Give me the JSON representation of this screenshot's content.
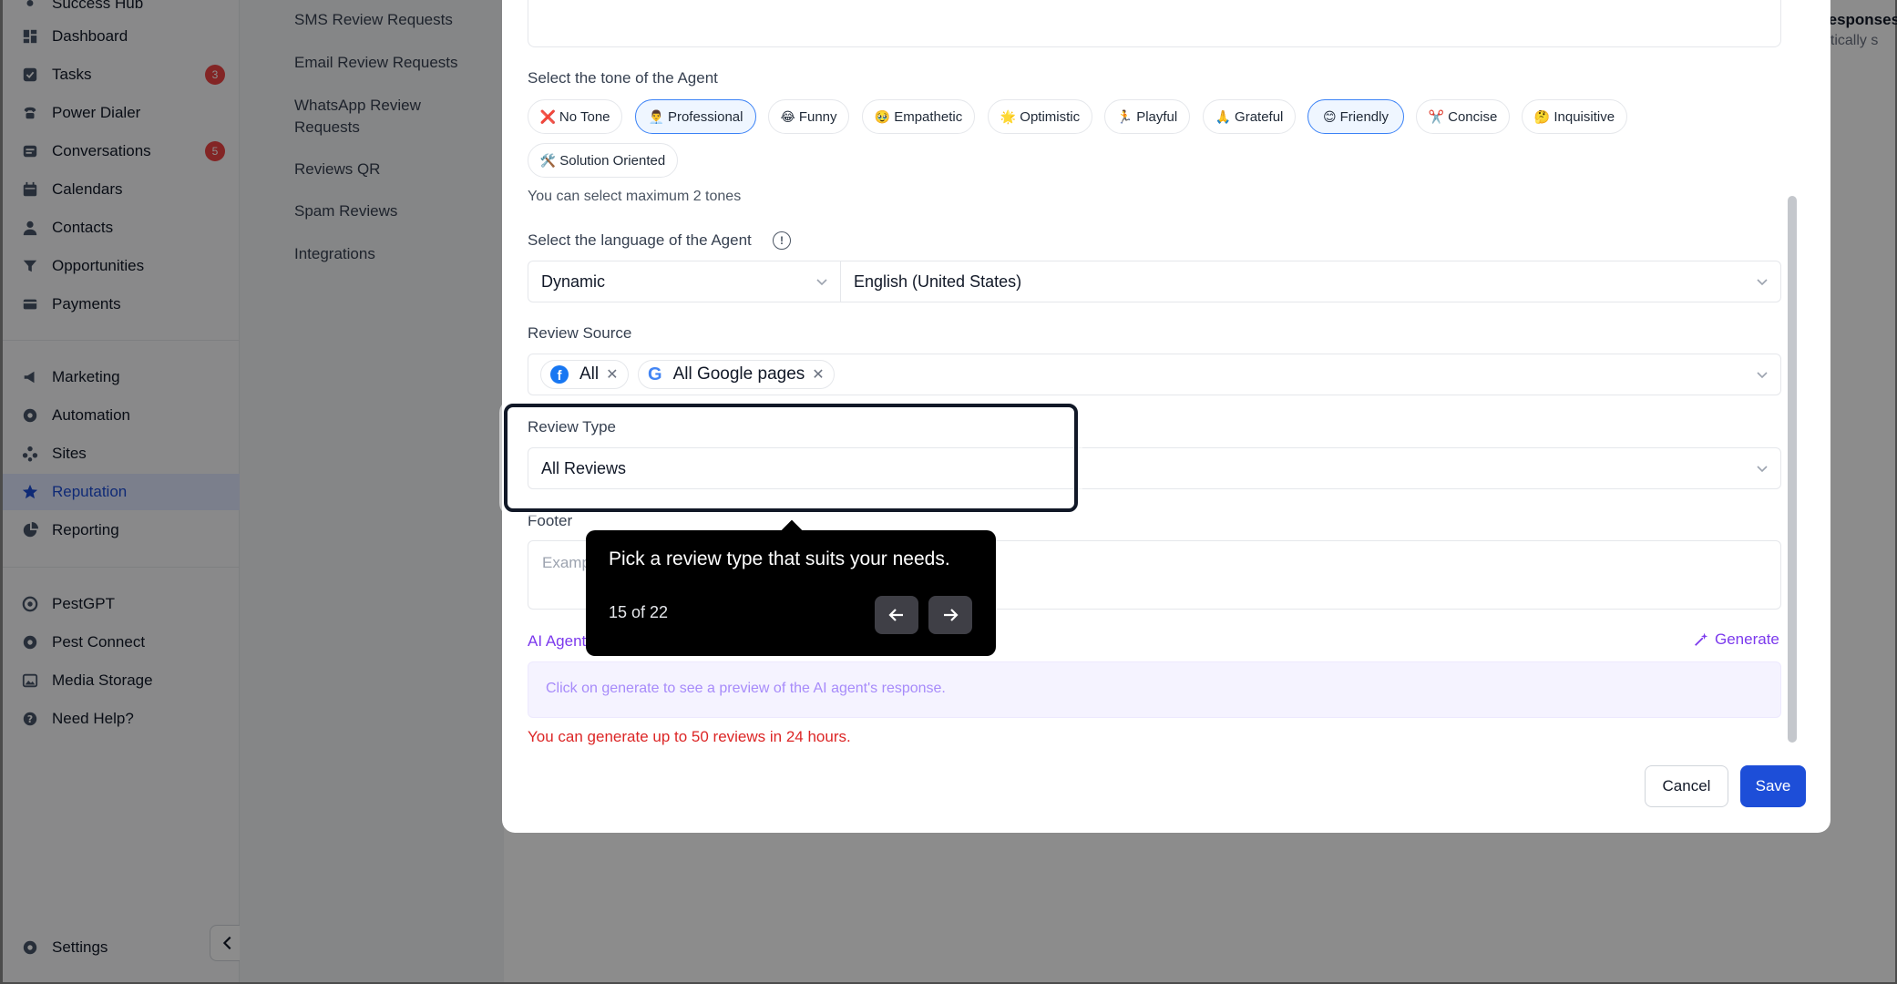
{
  "sidebar": {
    "partial_top": "Success Hub",
    "items": [
      {
        "label": "Dashboard",
        "icon": "dashboard-icon"
      },
      {
        "label": "Tasks",
        "icon": "tasks-icon",
        "badge": "3"
      },
      {
        "label": "Power Dialer",
        "icon": "phone-icon"
      },
      {
        "label": "Conversations",
        "icon": "chat-icon",
        "badge": "5"
      },
      {
        "label": "Calendars",
        "icon": "calendar-icon"
      },
      {
        "label": "Contacts",
        "icon": "user-icon"
      },
      {
        "label": "Opportunities",
        "icon": "filter-icon"
      },
      {
        "label": "Payments",
        "icon": "card-icon"
      },
      {
        "label": "Marketing",
        "icon": "megaphone-icon"
      },
      {
        "label": "Automation",
        "icon": "automation-icon"
      },
      {
        "label": "Sites",
        "icon": "sites-icon"
      },
      {
        "label": "Reputation",
        "icon": "star-icon",
        "active": true
      },
      {
        "label": "Reporting",
        "icon": "chart-icon"
      },
      {
        "label": "PestGPT",
        "icon": "gpt-icon"
      },
      {
        "label": "Pest Connect",
        "icon": "connect-icon"
      },
      {
        "label": "Media Storage",
        "icon": "image-icon"
      },
      {
        "label": "Need Help?",
        "icon": "help-icon"
      },
      {
        "label": "Settings",
        "icon": "gear-icon"
      }
    ]
  },
  "subnav": {
    "items": [
      "SMS Review Requests",
      "Email Review Requests",
      "WhatsApp Review Requests",
      "Reviews QR",
      "Spam Reviews",
      "Integrations"
    ]
  },
  "background": {
    "heading": "responses",
    "sub": "atically s"
  },
  "modal": {
    "tone_label": "Select the tone of the Agent",
    "tones": [
      {
        "emoji": "❌",
        "label": "No Tone"
      },
      {
        "emoji": "👨‍💼",
        "label": "Professional",
        "selected": true
      },
      {
        "emoji": "😂",
        "label": "Funny"
      },
      {
        "emoji": "🥹",
        "label": "Empathetic"
      },
      {
        "emoji": "🌟",
        "label": "Optimistic"
      },
      {
        "emoji": "🏃",
        "label": "Playful"
      },
      {
        "emoji": "🙏",
        "label": "Grateful"
      },
      {
        "emoji": "😊",
        "label": "Friendly",
        "selected": true
      },
      {
        "emoji": "✂️",
        "label": "Concise"
      },
      {
        "emoji": "🤔",
        "label": "Inquisitive"
      },
      {
        "emoji": "🛠️",
        "label": "Solution Oriented"
      }
    ],
    "tone_helper": "You can select maximum 2 tones",
    "language_label": "Select the language of the Agent",
    "language_mode": "Dynamic",
    "language_value": "English (United States)",
    "review_source_label": "Review Source",
    "sources": [
      {
        "label": "All",
        "icon": "facebook-icon"
      },
      {
        "label": "All Google pages",
        "icon": "google-icon"
      }
    ],
    "review_type_label": "Review Type",
    "review_type_value": "All Reviews",
    "footer_label": "Footer",
    "footer_placeholder": "Examp",
    "ai_agent_label": "AI Agent",
    "generate_label": "Generate",
    "preview_text": "Click on generate to see a preview of the AI agent's response.",
    "warning": "You can generate up to 50 reviews in 24 hours.",
    "cancel_label": "Cancel",
    "save_label": "Save"
  },
  "tour": {
    "text": "Pick a review type that suits your needs.",
    "count": "15 of 22"
  }
}
